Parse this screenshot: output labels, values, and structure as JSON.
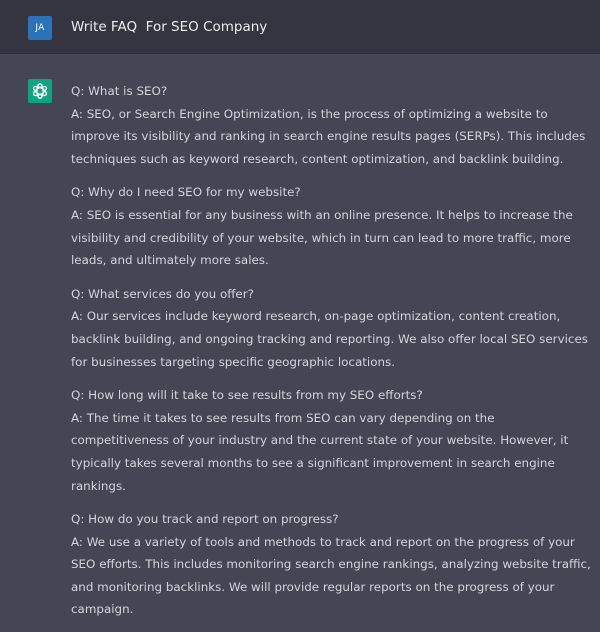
{
  "user": {
    "avatar_initials": "JA",
    "prompt": "Write FAQ  For SEO Company"
  },
  "assistant": {
    "avatar_icon": "openai-logo-icon",
    "faq": [
      {
        "question": "Q: What is SEO?",
        "answer": "A: SEO, or Search Engine Optimization, is the process of optimizing a website to improve its visibility and ranking in search engine results pages (SERPs). This includes techniques such as keyword research, content optimization, and backlink building."
      },
      {
        "question": "Q: Why do I need SEO for my website?",
        "answer": "A: SEO is essential for any business with an online presence. It helps to increase the visibility and credibility of your website, which in turn can lead to more traffic, more leads, and ultimately more sales."
      },
      {
        "question": "Q: What services do you offer?",
        "answer": "A: Our services include keyword research, on-page optimization, content creation, backlink building, and ongoing tracking and reporting. We also offer local SEO services for businesses targeting specific geographic locations."
      },
      {
        "question": "Q: How long will it take to see results from my SEO efforts?",
        "answer": "A: The time it takes to see results from SEO can vary depending on the competitiveness of your industry and the current state of your website. However, it typically takes several months to see a significant improvement in search engine rankings."
      },
      {
        "question": "Q: How do you track and report on progress?",
        "answer": "A: We use a variety of tools and methods to track and report on the progress of your SEO efforts. This includes monitoring search engine rankings, analyzing website traffic, and monitoring backlinks. We will provide regular reports on the progress of your campaign."
      }
    ]
  },
  "colors": {
    "user_row_bg": "#343541",
    "assistant_row_bg": "#444654",
    "user_avatar_bg": "#2b73b8",
    "assistant_avatar_bg": "#10a37f",
    "text": "#d1d5db"
  }
}
